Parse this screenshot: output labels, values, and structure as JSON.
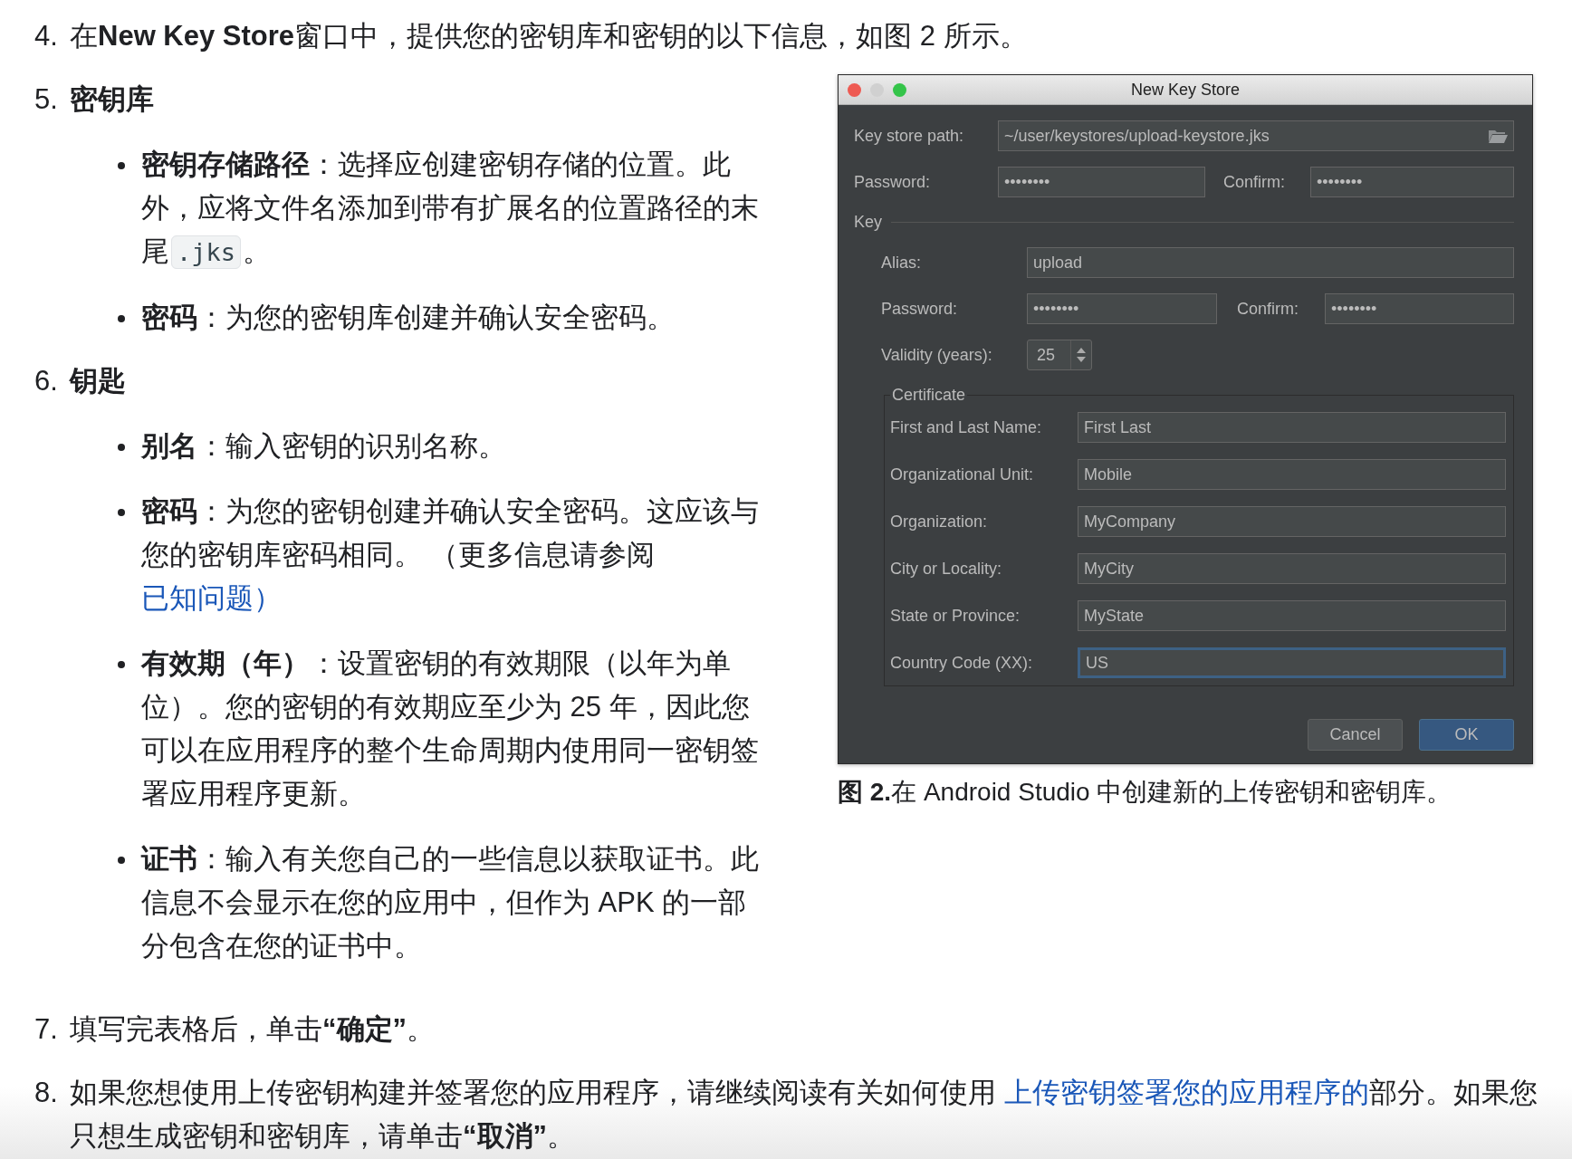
{
  "intro": {
    "number": "4.",
    "parts": [
      {
        "kind": "text",
        "text": "在**New Key Store**窗口中，提供您的密钥库和密钥的以下信息，如图 2 所示。"
      }
    ]
  },
  "sections": [
    {
      "number": "5.",
      "heading": "密钥库",
      "bullets": [
        {
          "parts": [
            {
              "kind": "text",
              "text": "**密钥存储路径**：选择应创建密钥存储的位置。此外，应将文件名添加到带有扩展名的位置路径的末尾"
            },
            {
              "kind": "code",
              "text": ".jks"
            },
            {
              "kind": "text",
              "text": "。"
            }
          ]
        },
        {
          "parts": [
            {
              "kind": "text",
              "text": "**密码**：为您的密钥库创建并确认安全密码。"
            }
          ]
        }
      ]
    },
    {
      "number": "6.",
      "heading": "钥匙",
      "bullets": [
        {
          "parts": [
            {
              "kind": "text",
              "text": "**别名**：输入密钥的识别名称。"
            }
          ]
        },
        {
          "parts": [
            {
              "kind": "text",
              "text": "**密码**：为您的密钥创建并确认安全密码。这应该与您的密钥库密码相同。 （更多信息请参阅"
            },
            {
              "kind": "link",
              "text": "已知问题）"
            }
          ]
        },
        {
          "parts": [
            {
              "kind": "text",
              "text": "**有效期（年）**：设置密钥的有效期限（以年为单位）。您的密钥的有效期应至少为 25 年，因此您可以在应用程序的整个生命周期内使用同一密钥签署应用程序更新。"
            }
          ]
        },
        {
          "parts": [
            {
              "kind": "text",
              "text": "**证书**：输入有关您自己的一些信息以获取证书。此信息不会显示在您的应用中，但作为 APK 的一部分包含在您的证书中。"
            }
          ]
        }
      ]
    }
  ],
  "steps": [
    {
      "number": "7.",
      "parts": [
        {
          "kind": "text",
          "text": "填写完表格后，单击**“确定”**。"
        }
      ]
    },
    {
      "number": "8.",
      "parts": [
        {
          "kind": "text",
          "text": "如果您想使用上传密钥构建并签署您的应用程序，请继续阅读有关如何使用 "
        },
        {
          "kind": "link",
          "text": "上传密钥签署您的应用程序的"
        },
        {
          "kind": "text",
          "text": "部分。如果您只想生成密钥和密钥库，请单击**“取消”**。"
        }
      ]
    }
  ],
  "dialog": {
    "title": "New Key Store",
    "window_buttons": [
      {
        "color": "#ee5a52"
      },
      {
        "color": "#d0d0d0"
      },
      {
        "color": "#34c449"
      }
    ],
    "key_store_path": {
      "label": "Key store path:",
      "value": "~/user/keystores/upload-keystore.jks"
    },
    "store_password": {
      "label": "Password:",
      "value": "••••••••"
    },
    "store_confirm": {
      "label": "Confirm:",
      "value": "••••••••"
    },
    "key_section": "Key",
    "alias": {
      "label": "Alias:",
      "value": "upload"
    },
    "key_password": {
      "label": "Password:",
      "value": "••••••••"
    },
    "key_confirm": {
      "label": "Confirm:",
      "value": "••••••••"
    },
    "validity": {
      "label": "Validity (years):",
      "value": "25"
    },
    "certificate": {
      "title": "Certificate",
      "fields": [
        {
          "label": "First and Last Name:",
          "value": "First Last",
          "focused": false
        },
        {
          "label": "Organizational Unit:",
          "value": "Mobile",
          "focused": false
        },
        {
          "label": "Organization:",
          "value": "MyCompany",
          "focused": false
        },
        {
          "label": "City or Locality:",
          "value": "MyCity",
          "focused": false
        },
        {
          "label": "State or Province:",
          "value": "MyState",
          "focused": false
        },
        {
          "label": "Country Code (XX):",
          "value": "US",
          "focused": true
        }
      ]
    },
    "buttons": [
      {
        "label": "Cancel",
        "default": false
      },
      {
        "label": "OK",
        "default": true
      }
    ]
  },
  "caption": "**图 2.**在 Android Studio 中创建新的上传密钥和密钥库。"
}
